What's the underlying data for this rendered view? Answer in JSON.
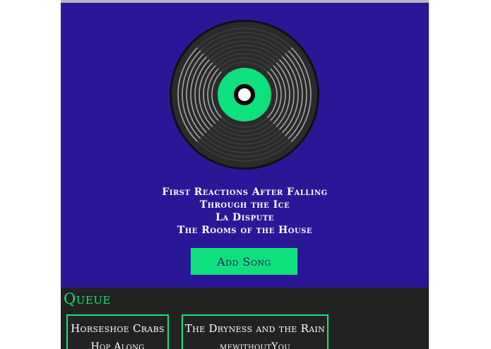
{
  "colors": {
    "player_bg": "#2a1798",
    "accent": "#0fe07e",
    "queue_bg": "#222222",
    "text": "#ffffff"
  },
  "player": {
    "record_icon": "vinyl-record-icon",
    "track_title_line1": "First Reactions After Falling",
    "track_title_line2": "Through the Ice",
    "artist": "La Dispute",
    "album": "The Rooms of the House",
    "add_song_label": "Add Song"
  },
  "queue": {
    "title": "Queue",
    "items": [
      {
        "title": "Horseshoe Crabs",
        "artist": "Hop Along"
      },
      {
        "title": "The Dryness and the Rain",
        "artist": "mewithoutYou"
      }
    ]
  }
}
